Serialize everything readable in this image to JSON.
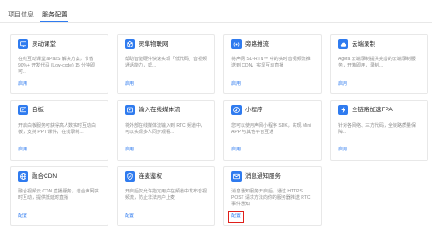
{
  "tabs": [
    {
      "label": "项目信息",
      "active": false
    },
    {
      "label": "服务配置",
      "active": true
    }
  ],
  "services": [
    {
      "title": "灵动课堂",
      "icon": "classroom-icon",
      "description": "在线互动课堂 aPaaS 解决方案，节省 90%+ 开发代码 (Low-code) 15 分钟即可...",
      "action": "启用"
    },
    {
      "title": "灵隼物联网",
      "icon": "iot-icon",
      "description": "帮助智能硬件快速实现「低代码」音视频通话能力，帮...",
      "action": "启用"
    },
    {
      "title": "旁路推流",
      "icon": "stream-push-icon",
      "description": "将声网 SD-RTN™ 中的实时音视频流推送到 CDN，实现互动直播",
      "action": "启用"
    },
    {
      "title": "云端录制",
      "icon": "cloud-recording-icon",
      "description": "Agora 云端录制提供完善的云端录制服务，开箱即用，录制...",
      "action": "启用"
    },
    {
      "title": "白板",
      "icon": "whiteboard-icon",
      "description": "开启白板服务可获得高人数实时互动白板，支持 PPT 课件，在线录制...",
      "action": "启用"
    },
    {
      "title": "输入在线媒体流",
      "icon": "media-input-icon",
      "description": "将外部在线媒体流输入到 RTC 频道中，可以实现多人同步观看...",
      "action": "启用"
    },
    {
      "title": "小程序",
      "icon": "mini-program-icon",
      "description": "您可以使用声网小程序 SDK，实现 Mini APP 与其他平台互通",
      "action": "启用"
    },
    {
      "title": "全链路加速FPA",
      "icon": "fpa-icon",
      "description": "针对各网络、三方代码，全链路质量保障...",
      "action": "启用"
    },
    {
      "title": "融合CDN",
      "icon": "cdn-icon",
      "description": "融合视频云 CDN 直播服务，结合声网实时互动，提供低延时直播",
      "action": "配置"
    },
    {
      "title": "连麦鉴权",
      "icon": "auth-icon",
      "description": "开启后仅允许指定用户在频道中发布音视频流，防止非法用户上麦",
      "action": "配置"
    },
    {
      "title": "消息通知服务",
      "icon": "notification-icon",
      "description": "消息通知服务开启后，通过 HTTPS POST 请求方法向你的服务器推送 RTC 事件通知",
      "action": "配置",
      "highlighted": true
    }
  ],
  "colors": {
    "accent": "#2f7bef",
    "title_text": "#262626",
    "muted_text": "#8c8c8c",
    "card_border": "#e8e8e8",
    "highlight_box": "#e0201b",
    "tab_text": "#595959"
  }
}
